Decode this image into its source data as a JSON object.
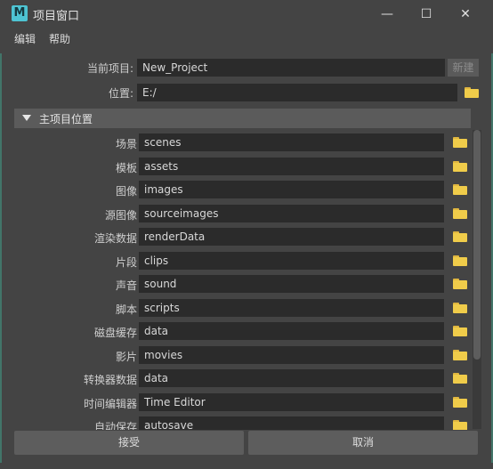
{
  "window": {
    "title": "项目窗口",
    "app_icon_letter": "M",
    "controls": {
      "minimize": "—",
      "maximize": "☐",
      "close": "✕"
    }
  },
  "menubar": [
    "编辑",
    "帮助"
  ],
  "current_project": {
    "label": "当前项目:",
    "value": "New_Project",
    "new_button": "新建"
  },
  "location": {
    "label": "位置:",
    "value": "E:/"
  },
  "section": {
    "title": "主项目位置",
    "expanded": true
  },
  "rows": [
    {
      "label": "场景",
      "value": "scenes"
    },
    {
      "label": "模板",
      "value": "assets"
    },
    {
      "label": "图像",
      "value": "images"
    },
    {
      "label": "源图像",
      "value": "sourceimages"
    },
    {
      "label": "渲染数据",
      "value": "renderData"
    },
    {
      "label": "片段",
      "value": "clips"
    },
    {
      "label": "声音",
      "value": "sound"
    },
    {
      "label": "脚本",
      "value": "scripts"
    },
    {
      "label": "磁盘缓存",
      "value": "data"
    },
    {
      "label": "影片",
      "value": "movies"
    },
    {
      "label": "转换器数据",
      "value": "data"
    },
    {
      "label": "时间编辑器",
      "value": "Time Editor"
    },
    {
      "label": "自动保存",
      "value": "autosave"
    }
  ],
  "buttons": {
    "accept": "接受",
    "cancel": "取消"
  },
  "colors": {
    "folder": "#f0cc4a",
    "field_bg": "#2b2b2b",
    "accent": "#4ec4d3"
  }
}
